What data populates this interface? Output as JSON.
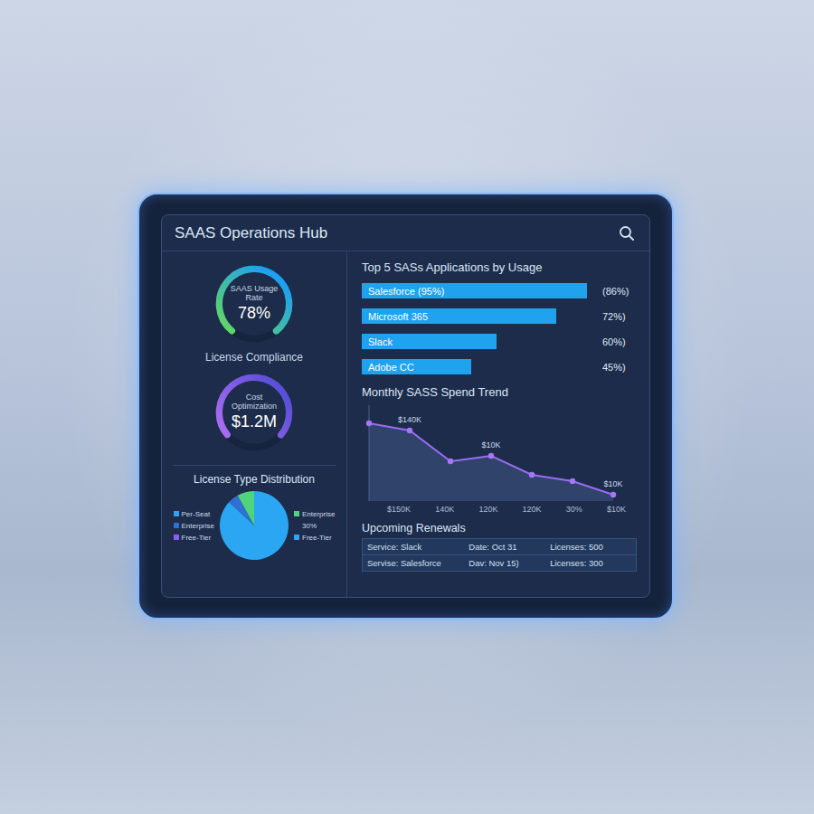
{
  "window": {
    "title": "SAAS Operations Hub"
  },
  "gauges": [
    {
      "label": "SAAS Usage Rate",
      "value": "78%",
      "level": 0.78,
      "color": "#1e9ff2",
      "color_end": "#5fd46b"
    },
    {
      "label": "Cost Optimization",
      "value": "$1.2M",
      "level": 0.72,
      "color": "#5b4fd8",
      "color_end": "#a66cf0"
    }
  ],
  "compliance_caption": "License Compliance",
  "distribution": {
    "title": "License Type Distribution",
    "slices": [
      {
        "name": "Per-Seat",
        "value": 87,
        "color": "#2aa6f2"
      },
      {
        "name": "Enterprise",
        "value": 5,
        "color": "#2f6fd6"
      },
      {
        "name": "Free-Tier",
        "value": 8,
        "color": "#4fd37c"
      }
    ],
    "legend_left": [
      {
        "label": "Per-Seat",
        "marker": true,
        "color": "#2aa6f2"
      },
      {
        "label": "Enterprise",
        "marker": true,
        "color": "#2f6fd6"
      },
      {
        "label": "Free-Tier",
        "marker": true,
        "color": "#8b5cf6"
      }
    ],
    "legend_right": [
      {
        "label": "Enterprise",
        "marker": true,
        "color": "#4fd37c"
      },
      {
        "label": "30%",
        "marker": false,
        "color": "#2aa6f2"
      },
      {
        "label": "Free-Tier",
        "marker": true,
        "color": "#2aa6f2"
      }
    ]
  },
  "top_apps": {
    "title": "Top 5 SASs Applications by Usage",
    "bars": [
      {
        "label": "Salesforce (95%)",
        "value": "(86%)",
        "level": 0.95
      },
      {
        "label": "Microsoft 365",
        "value": "72%)",
        "level": 0.82
      },
      {
        "label": "Slack",
        "value": "60%)",
        "level": 0.57
      },
      {
        "label": "Adobe CC",
        "value": "45%)",
        "level": 0.46
      }
    ]
  },
  "spend_trend": {
    "title": "Monthly SASS Spend Trend",
    "series": [
      {
        "name": "Spend",
        "values": [
          140,
          132,
          98,
          104,
          83,
          76,
          61
        ]
      }
    ],
    "point_labels": [
      "",
      "$140K",
      "",
      "$10K",
      "",
      "",
      "$10K"
    ],
    "x_ticks": [
      "$150K",
      "140K",
      "120K",
      "120K",
      "30%",
      "$10K"
    ]
  },
  "renewals": {
    "title": "Upcoming Renewals",
    "rows": [
      [
        "Service: Slack",
        "Date: Oct 31",
        "Licenses: 500"
      ],
      [
        "Servise: Salesforce",
        "Dav: Nov 15)",
        "Licenses: 300"
      ]
    ]
  }
}
